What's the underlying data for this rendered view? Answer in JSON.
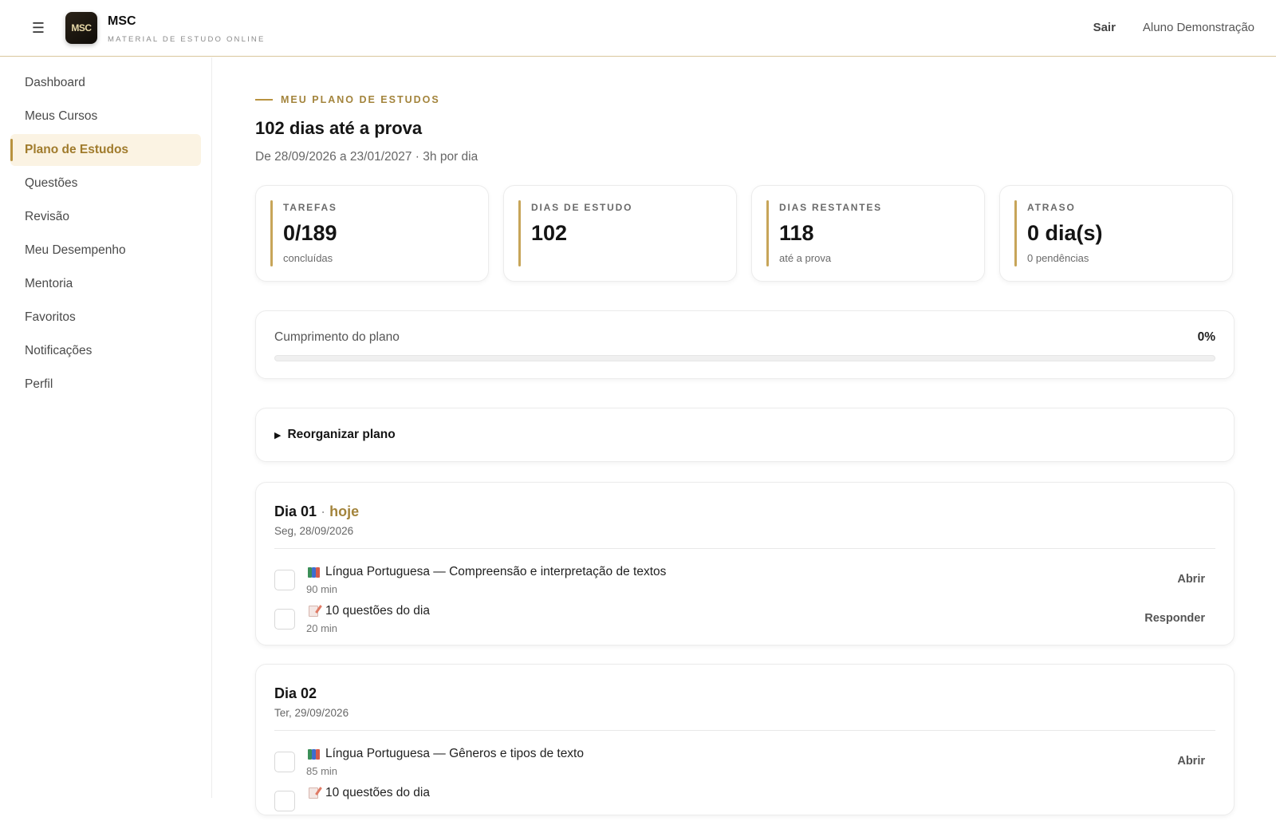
{
  "header": {
    "menu_icon": "hamburger-icon",
    "logo_text": "MSC",
    "brand_name": "MSC",
    "brand_subtitle": "MATERIAL DE ESTUDO ONLINE",
    "logout_label": "Sair",
    "user_name": "Aluno Demonstração"
  },
  "sidebar": {
    "items": [
      {
        "label": "Dashboard"
      },
      {
        "label": "Meus Cursos"
      },
      {
        "label": "Plano de Estudos",
        "active": true
      },
      {
        "label": "Questões"
      },
      {
        "label": "Revisão"
      },
      {
        "label": "Meu Desempenho"
      },
      {
        "label": "Mentoria"
      },
      {
        "label": "Favoritos"
      },
      {
        "label": "Notificações"
      },
      {
        "label": "Perfil"
      }
    ]
  },
  "page": {
    "eyebrow": "MEU PLANO DE ESTUDOS",
    "title": "102 dias até a prova",
    "subtitle": "De 28/09/2026 a 23/01/2027 · 3h por dia"
  },
  "stats": [
    {
      "label": "TAREFAS",
      "value": "0/189",
      "note": "concluídas"
    },
    {
      "label": "DIAS DE ESTUDO",
      "value": "102",
      "note": ""
    },
    {
      "label": "DIAS RESTANTES",
      "value": "118",
      "note": "até a prova"
    },
    {
      "label": "ATRASO",
      "value": "0 dia(s)",
      "note": "0 pendências"
    }
  ],
  "progress": {
    "label": "Cumprimento do plano",
    "percent_text": "0%",
    "fraction": 0
  },
  "reorganize": {
    "caret_icon": "caret-right-icon",
    "label": "Reorganizar plano"
  },
  "days": [
    {
      "title": "Dia 01",
      "separator": "·",
      "today_label": "hoje",
      "date": "Seg, 28/09/2026",
      "tasks": [
        {
          "icon": "books-icon",
          "title": "Língua Portuguesa — Compreensão e interpretação de textos",
          "duration": "90 min",
          "action": "Abrir"
        },
        {
          "icon": "memo-icon",
          "title": "10 questões do dia",
          "duration": "20 min",
          "action": "Responder"
        }
      ]
    },
    {
      "title": "Dia 02",
      "date": "Ter, 29/09/2026",
      "tasks": [
        {
          "icon": "books-icon",
          "title": "Língua Portuguesa — Gêneros e tipos de texto",
          "duration": "85 min",
          "action": "Abrir"
        },
        {
          "icon": "memo-icon",
          "title": "10 questões do dia",
          "duration": "",
          "action": ""
        }
      ]
    }
  ],
  "colors": {
    "accent": "#a3843c",
    "accent_bar": "#c7a559",
    "active_bg": "#fbf3e3"
  }
}
